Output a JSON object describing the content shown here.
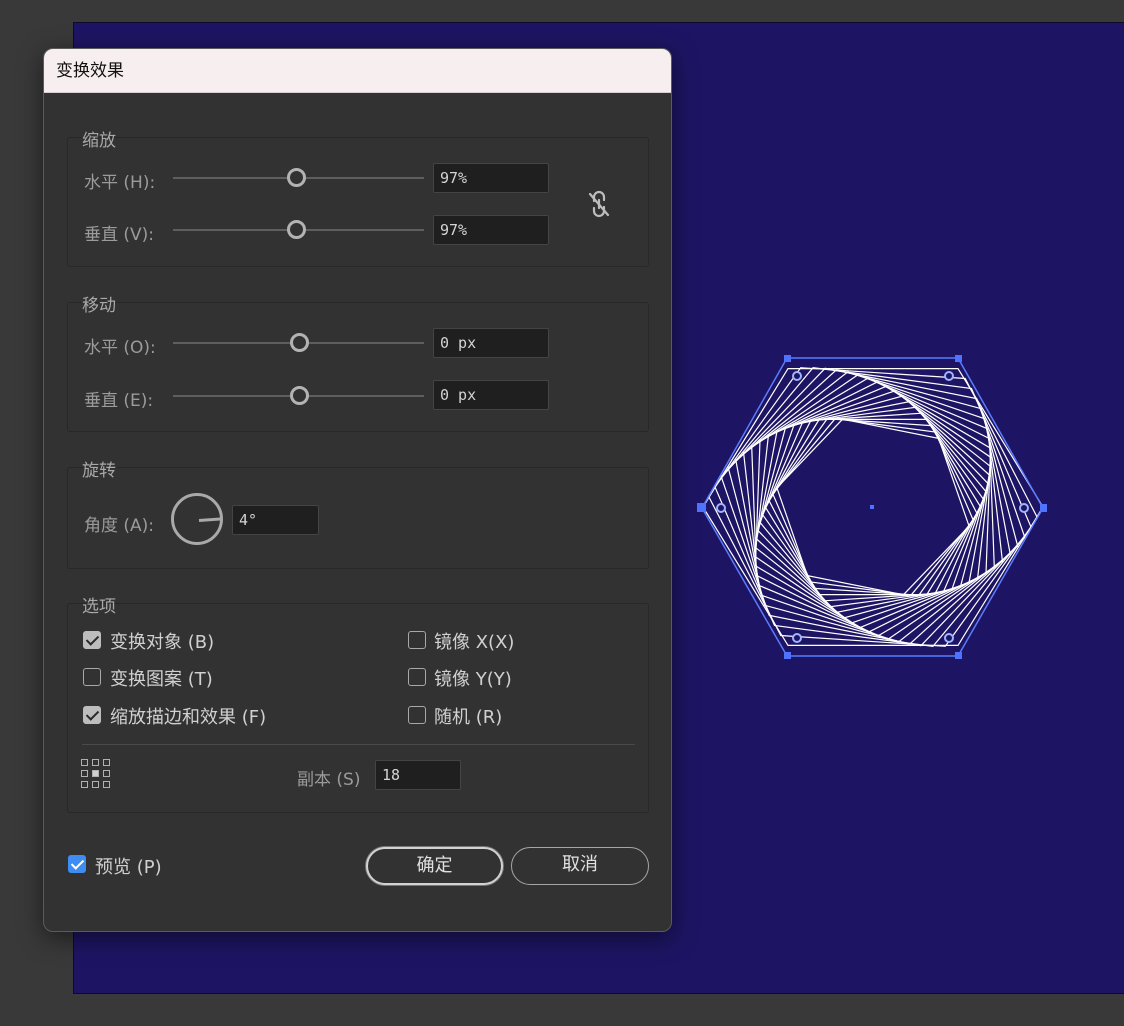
{
  "dialog": {
    "title": "变换效果",
    "scale": {
      "legend": "缩放",
      "horizontal_label": "水平 (H):",
      "horizontal_value": "97%",
      "horizontal_slider_fraction": 0.49,
      "vertical_label": "垂直 (V):",
      "vertical_value": "97%",
      "vertical_slider_fraction": 0.49
    },
    "move": {
      "legend": "移动",
      "horizontal_label": "水平 (O):",
      "horizontal_value": "0 px",
      "horizontal_slider_fraction": 0.5,
      "vertical_label": "垂直 (E):",
      "vertical_value": "0 px",
      "vertical_slider_fraction": 0.5
    },
    "rotate": {
      "legend": "旋转",
      "angle_label": "角度 (A):",
      "angle_value": "4°",
      "angle_degrees": 4
    },
    "options": {
      "legend": "选项",
      "transform_objects": {
        "label": "变换对象 (B)",
        "checked": true
      },
      "transform_patterns": {
        "label": "变换图案 (T)",
        "checked": false
      },
      "scale_strokes": {
        "label": "缩放描边和效果 (F)",
        "checked": true
      },
      "reflect_x": {
        "label": "镜像 X(X)",
        "checked": false
      },
      "reflect_y": {
        "label": "镜像 Y(Y)",
        "checked": false
      },
      "random": {
        "label": "随机 (R)",
        "checked": false
      },
      "copies_label": "副本 (S)",
      "copies_value": "18"
    },
    "preview": {
      "label": "预览 (P)",
      "checked": true
    },
    "ok_label": "确定",
    "cancel_label": "取消"
  },
  "colors": {
    "artboard": "#1d1563",
    "canvas_bg": "#393939",
    "dialog_bg": "#323232",
    "selection": "#4f72ff",
    "checkbox_accent": "#3d8df2"
  },
  "icons": [
    "link-off-icon",
    "reference-point-icon",
    "checkmark-icon"
  ]
}
